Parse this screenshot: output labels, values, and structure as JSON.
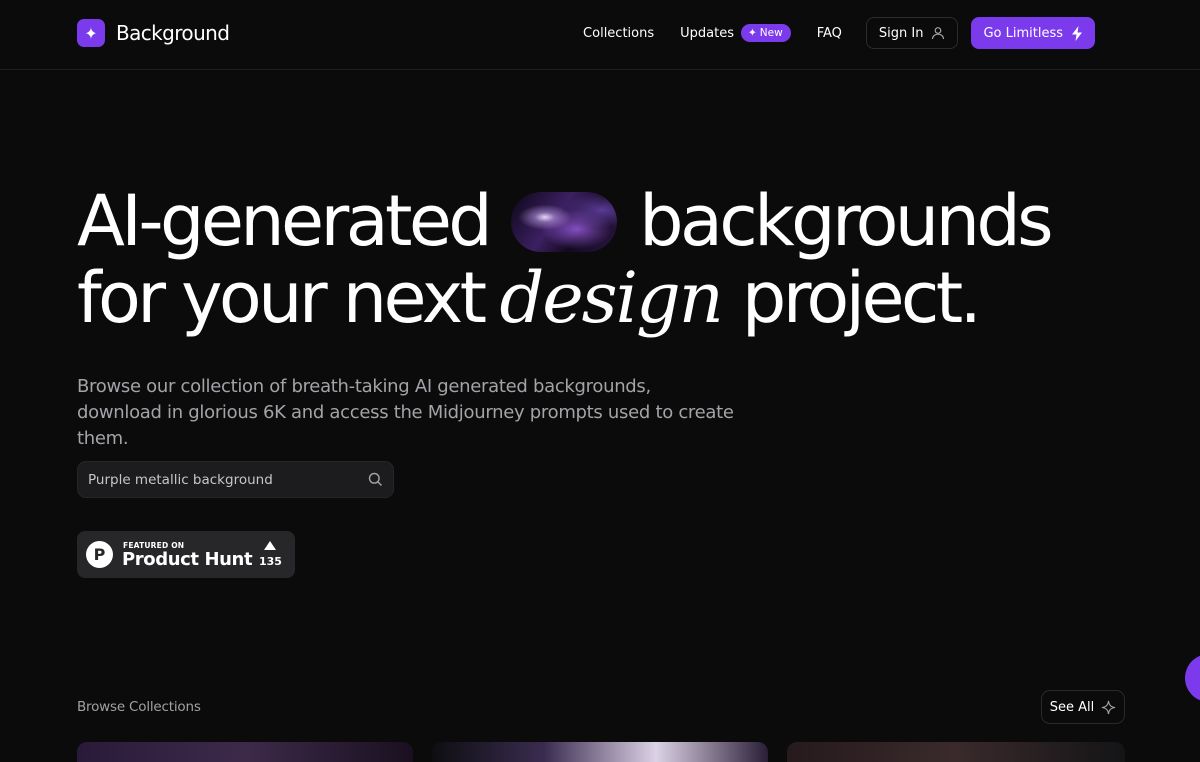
{
  "brand": {
    "name": "Background",
    "logo_icon": "sparkle-icon"
  },
  "nav": {
    "collections": "Collections",
    "updates": "Updates",
    "new_badge": "New",
    "faq": "FAQ",
    "sign_in": "Sign In",
    "go_limitless": "Go Limitless"
  },
  "hero": {
    "line1_a": "AI-generated",
    "line1_b": "backgrounds",
    "line2_a": "for your next",
    "line2_italic": "design",
    "line2_b": "project.",
    "subtitle": "Browse our collection of breath-taking AI generated backgrounds, download in glorious 6K and access the Midjourney prompts used to create them."
  },
  "search": {
    "placeholder": "Purple metallic background",
    "value": ""
  },
  "product_hunt": {
    "logo_letter": "P",
    "featured": "FEATURED ON",
    "name": "Product Hunt",
    "votes": "135"
  },
  "browse": {
    "label": "Browse Collections",
    "see_all": "See All"
  },
  "colors": {
    "accent": "#7c3aed",
    "background": "#0b0b0c",
    "muted_text": "#a3a3a8",
    "surface": "#1c1c1f"
  }
}
